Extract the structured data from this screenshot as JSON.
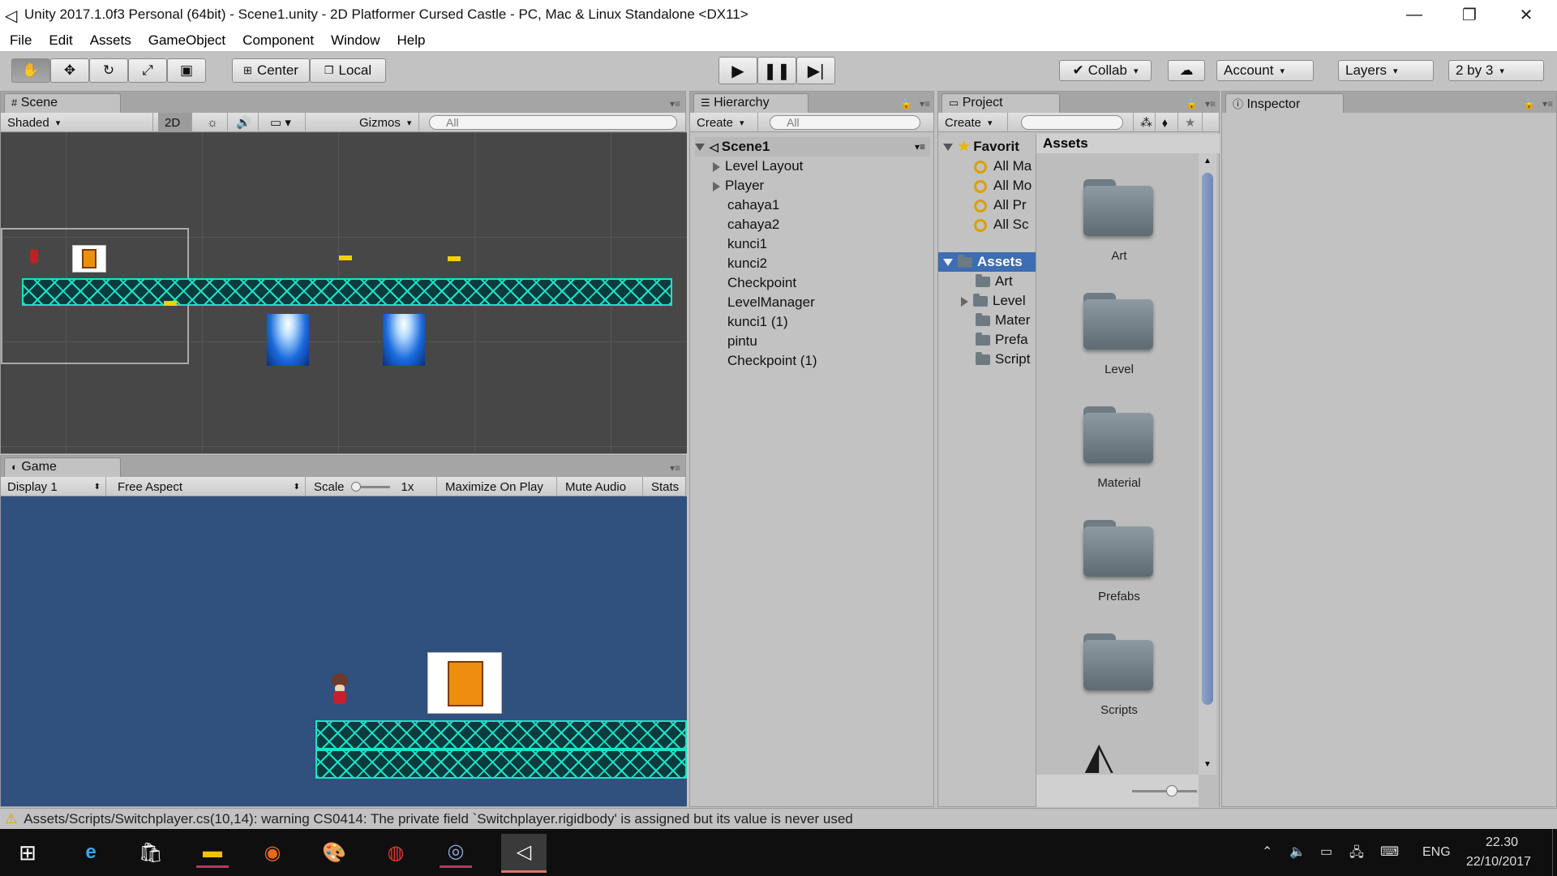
{
  "window": {
    "title": "Unity 2017.1.0f3 Personal (64bit) - Scene1.unity - 2D Platformer Cursed Castle - PC, Mac & Linux Standalone <DX11>",
    "min": "—",
    "max": "❐",
    "close": "✕"
  },
  "menu": [
    "File",
    "Edit",
    "Assets",
    "GameObject",
    "Component",
    "Window",
    "Help"
  ],
  "toolbar": {
    "center": "Center",
    "local": "Local",
    "collab": "Collab",
    "account": "Account",
    "layers": "Layers",
    "layout": "2 by 3"
  },
  "scene": {
    "tab": "Scene",
    "shading": "Shaded",
    "mode2d": "2D",
    "gizmos": "Gizmos",
    "search": "All"
  },
  "game": {
    "tab": "Game",
    "display": "Display 1",
    "aspect": "Free Aspect",
    "scale_label": "Scale",
    "scale_value": "1x",
    "maximize": "Maximize On Play",
    "mute": "Mute Audio",
    "stats": "Stats"
  },
  "hierarchy": {
    "tab": "Hierarchy",
    "create": "Create",
    "search": "All",
    "scene": "Scene1",
    "items": [
      "Level Layout",
      "Player",
      "cahaya1",
      "cahaya2",
      "kunci1",
      "kunci2",
      "Checkpoint",
      "LevelManager",
      "kunci1 (1)",
      "pintu",
      "Checkpoint (1)"
    ]
  },
  "project": {
    "tab": "Project",
    "create": "Create",
    "favorites": "Favorit",
    "fav_items": [
      "All Ma",
      "All Mo",
      "All Pr",
      "All Sc"
    ],
    "assets_root": "Assets",
    "tree": [
      "Art",
      "Level",
      "Mater",
      "Prefa",
      "Script"
    ],
    "assets_header": "Assets",
    "folders": [
      "Art",
      "Level",
      "Material",
      "Prefabs",
      "Scripts"
    ]
  },
  "inspector": {
    "tab": "Inspector"
  },
  "status": {
    "message": "Assets/Scripts/Switchplayer.cs(10,14): warning CS0414: The private field `Switchplayer.rigidbody' is assigned but its value is never used"
  },
  "taskbar": {
    "lang": "ENG",
    "time": "22.30",
    "date": "22/10/2017"
  }
}
